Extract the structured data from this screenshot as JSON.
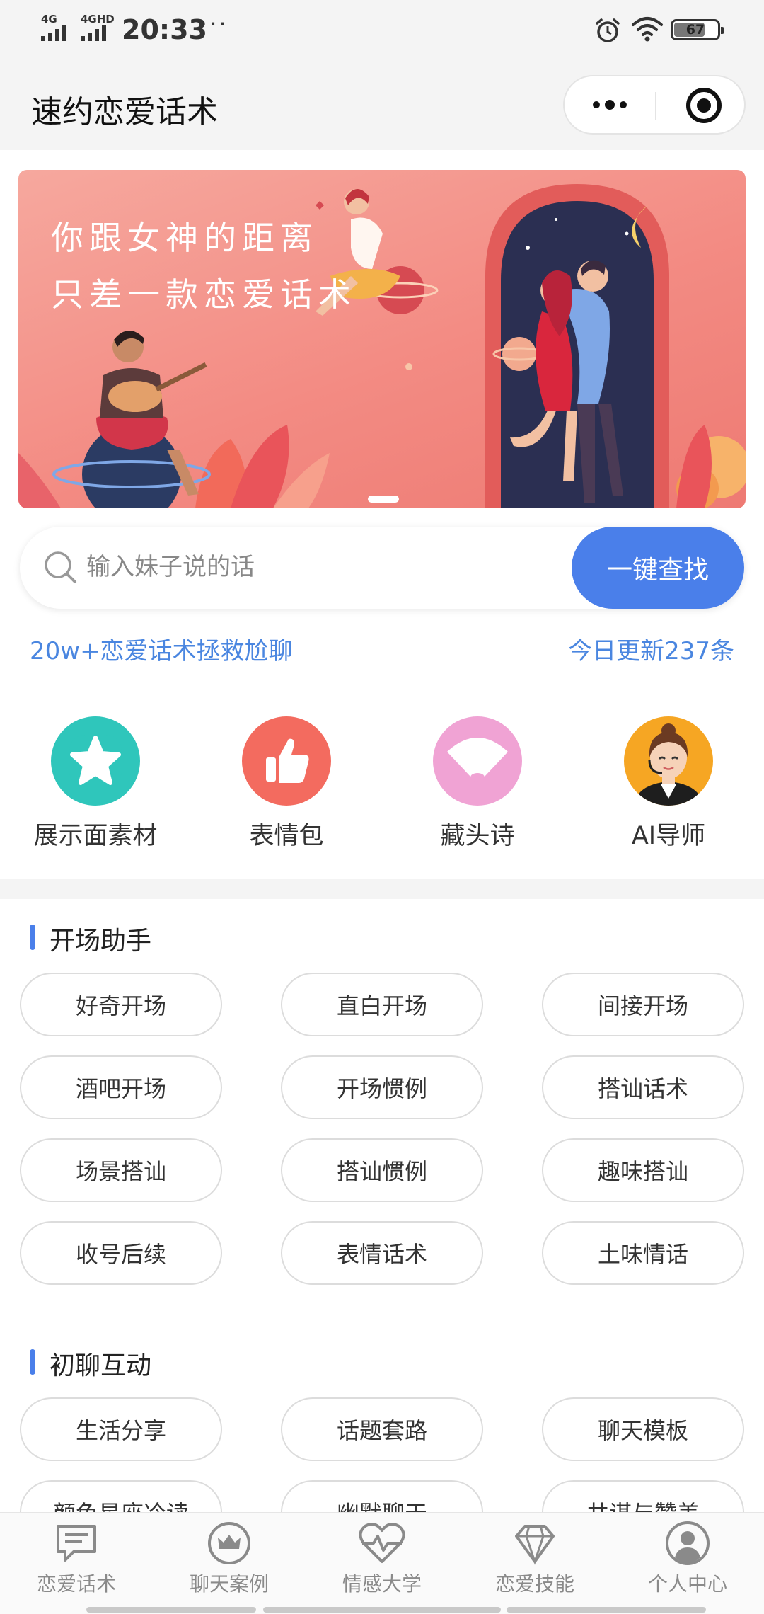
{
  "status_bar": {
    "signal1": "4G",
    "signal2": "4GHD",
    "time": "20:33",
    "dots": "···",
    "battery": "67",
    "battery_level": 0.67,
    "icons": [
      "alarm-icon",
      "wifi-icon",
      "battery-icon"
    ]
  },
  "title_bar": {
    "title": "速约恋爱话术",
    "icons": [
      "more-icon",
      "close-target-icon"
    ]
  },
  "banner": {
    "line1": "你跟女神的距离",
    "line2": "只差一款恋爱话术",
    "colors": {
      "pink": "#f38b83",
      "night": "#2b2f52"
    }
  },
  "search": {
    "placeholder": "输入妹子说的话",
    "value": "",
    "button": "一键查找",
    "accent": "#4a7fea"
  },
  "promo": {
    "left": "20w+恋爱话术拯救尬聊",
    "right": "今日更新237条"
  },
  "quick_entries": [
    {
      "label": "展示面素材",
      "icon": "star-icon",
      "color": "#2fc6bb"
    },
    {
      "label": "表情包",
      "icon": "thumbs-up-icon",
      "color": "#f36b5f"
    },
    {
      "label": "藏头诗",
      "icon": "fan-icon",
      "color": "#f0a3d4"
    },
    {
      "label": "AI导师",
      "icon": "mentor-avatar-icon",
      "color": "#f6a623"
    }
  ],
  "sections": [
    {
      "title": "开场助手",
      "items": [
        "好奇开场",
        "直白开场",
        "间接开场",
        "酒吧开场",
        "开场惯例",
        "搭讪话术",
        "场景搭讪",
        "搭讪惯例",
        "趣味搭讪",
        "收号后续",
        "表情话术",
        "土味情话"
      ]
    },
    {
      "title": "初聊互动",
      "items": [
        "生活分享",
        "话题套路",
        "聊天模板",
        "颜色星座冷读",
        "幽默聊天",
        "共谋与赞美"
      ]
    }
  ],
  "tab_bar": {
    "items": [
      {
        "label": "恋爱话术",
        "icon": "chat-bubble-icon"
      },
      {
        "label": "聊天案例",
        "icon": "crown-icon"
      },
      {
        "label": "情感大学",
        "icon": "heart-pulse-icon"
      },
      {
        "label": "恋爱技能",
        "icon": "diamond-icon"
      },
      {
        "label": "个人中心",
        "icon": "user-icon"
      }
    ]
  }
}
